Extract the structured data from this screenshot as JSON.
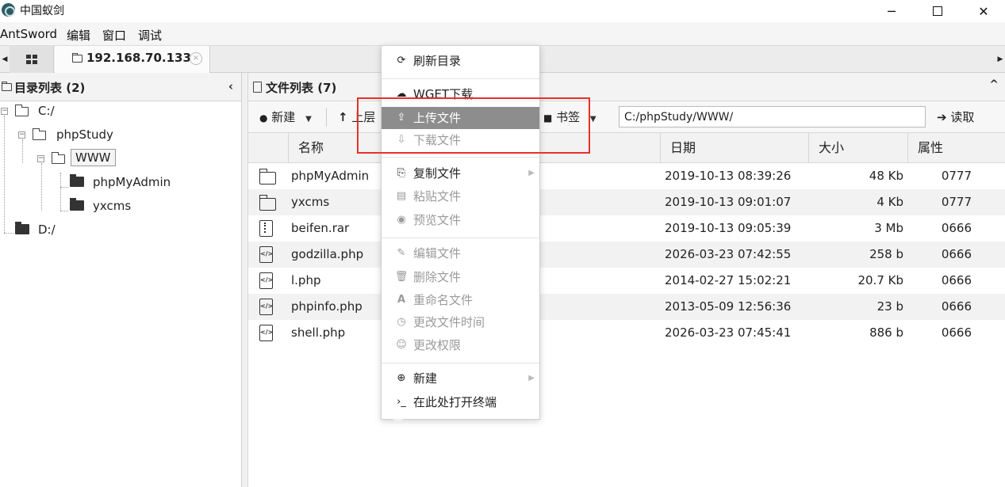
{
  "window": {
    "title": "中国蚁剑",
    "minimize": "─",
    "close": "✕"
  },
  "menubar": [
    "AntSword",
    "编辑",
    "窗口",
    "调试"
  ],
  "tabs": {
    "active_label": "192.168.70.133",
    "close": "×",
    "scroll_left": "◀",
    "scroll_right": "▶"
  },
  "left_panel": {
    "title": "目录列表 (2)",
    "collapse": "‹",
    "tree": {
      "c_drive": "C:/",
      "phpstudy": "phpStudy",
      "www": "WWW",
      "phpmyadmin": "phpMyAdmin",
      "yxcms": "yxcms",
      "d_drive": "D:/",
      "expander": "−"
    }
  },
  "right_panel": {
    "title": "文件列表 (7)",
    "collapse": "^",
    "toolbar": {
      "new": "新建",
      "up": "上层",
      "bookmark": "书签",
      "path_value": "C:/phpStudy/WWW/",
      "read": "读取",
      "caret": "▼",
      "plus_icon": "●",
      "up_icon": "↑",
      "bookmark_icon": "■",
      "read_icon": "➔"
    },
    "columns": [
      "名称",
      "日期",
      "大小",
      "属性"
    ],
    "files": [
      {
        "icon": "folder-icon",
        "name": "phpMyAdmin",
        "date": "2019-10-13 08:39:26",
        "size": "48 Kb",
        "attr": "0777"
      },
      {
        "icon": "folder-icon",
        "name": "yxcms",
        "date": "2019-10-13 09:01:07",
        "size": "4 Kb",
        "attr": "0777"
      },
      {
        "icon": "archive-file-icon",
        "name": "beifen.rar",
        "date": "2019-10-13 09:05:39",
        "size": "3 Mb",
        "attr": "0666"
      },
      {
        "icon": "code-file-icon",
        "name": "godzilla.php",
        "date": "2026-03-23 07:42:55",
        "size": "258 b",
        "attr": "0666"
      },
      {
        "icon": "code-file-icon",
        "name": "l.php",
        "date": "2014-02-27 15:02:21",
        "size": "20.7 Kb",
        "attr": "0666"
      },
      {
        "icon": "code-file-icon",
        "name": "phpinfo.php",
        "date": "2013-05-09 12:56:36",
        "size": "23 b",
        "attr": "0666"
      },
      {
        "icon": "code-file-icon",
        "name": "shell.php",
        "date": "2026-03-23 07:45:41",
        "size": "886 b",
        "attr": "0666"
      }
    ]
  },
  "context_menu": {
    "refresh": "刷新目录",
    "wget": "WGET下载",
    "upload": "上传文件",
    "download": "下载文件",
    "copy": "复制文件",
    "paste": "粘贴文件",
    "preview": "预览文件",
    "edit": "编辑文件",
    "delete": "删除文件",
    "rename": "重命名文件",
    "change_time": "更改文件时间",
    "change_perm": "更改权限",
    "new": "新建",
    "terminal": "在此处打开终端",
    "icons": {
      "refresh": "⟳",
      "wget": "☁",
      "upload": "⇪",
      "download": "⇩",
      "copy": "⎘",
      "paste": "▤",
      "preview": "◉",
      "edit": "✎",
      "delete": "🗑",
      "rename": "A",
      "change_time": "◷",
      "change_perm": "☺",
      "new": "⊕",
      "terminal": "›_",
      "submenu": "▶"
    }
  },
  "colors": {
    "highlight_box": "#e8302a",
    "menu_hover": "#8d8d8d"
  }
}
